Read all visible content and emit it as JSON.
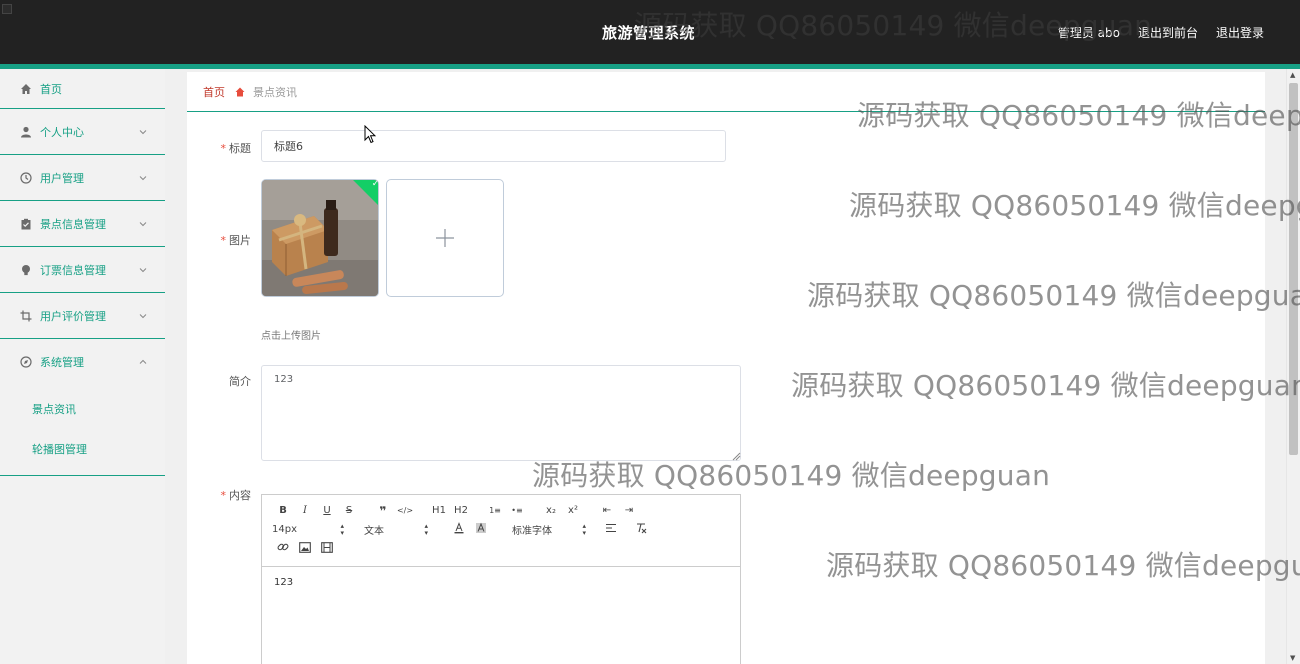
{
  "header": {
    "app_title": "旅游管理系统",
    "links": [
      "管理员 abo",
      "退出到前台",
      "退出登录"
    ],
    "background_color": "#222222",
    "accent_color": "#17a085"
  },
  "sidebar": {
    "items": [
      {
        "label": "首页",
        "icon": "home-icon",
        "expandable": false
      },
      {
        "label": "个人中心",
        "icon": "user-icon",
        "expandable": true
      },
      {
        "label": "用户管理",
        "icon": "clock-icon",
        "expandable": true
      },
      {
        "label": "景点信息管理",
        "icon": "clipboard-icon",
        "expandable": true
      },
      {
        "label": "订票信息管理",
        "icon": "bulb-icon",
        "expandable": true
      },
      {
        "label": "用户评价管理",
        "icon": "crop-icon",
        "expandable": true
      },
      {
        "label": "系统管理",
        "icon": "compass-icon",
        "expandable": true,
        "expanded": true
      }
    ],
    "submenu": [
      "景点资讯",
      "轮播图管理"
    ]
  },
  "breadcrumb": {
    "home": "首页",
    "current": "景点资讯"
  },
  "form": {
    "title_label": "标题",
    "title_value": "标题6",
    "image_label": "图片",
    "upload_hint": "点击上传图片",
    "intro_label": "简介",
    "intro_value": "123",
    "content_label": "内容",
    "content_value": "123",
    "required_mark": "*"
  },
  "editor_toolbar": {
    "row1": [
      "B",
      "I",
      "U",
      "S",
      "❞",
      "</>",
      "H1",
      "H2",
      "1≡",
      "•≡",
      "x₂",
      "x²",
      "⇤",
      "⇥"
    ],
    "font_size": "14px",
    "text_style": "文本",
    "font_family": "标准字体",
    "row3": [
      "link",
      "image",
      "video"
    ]
  },
  "watermark": {
    "text": "源码获取 QQ86050149 微信deepguan"
  }
}
